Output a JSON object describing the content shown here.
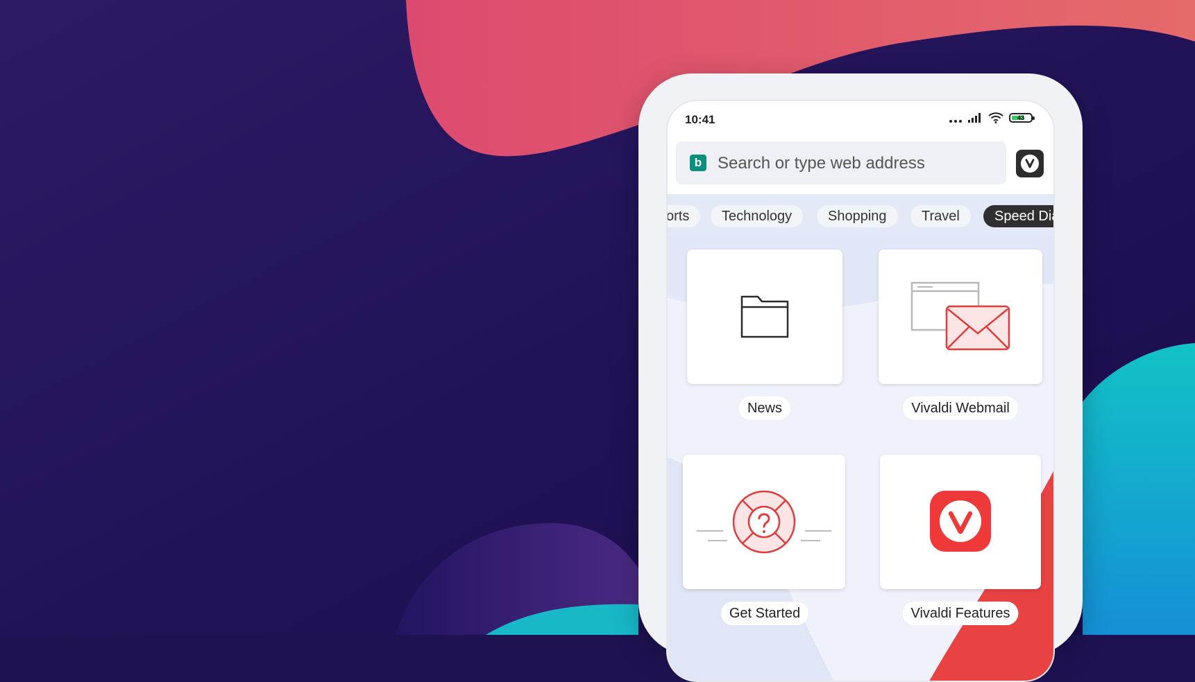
{
  "status_bar": {
    "time": "10:41",
    "battery_level": "43"
  },
  "address_bar": {
    "placeholder": "Search or type web address",
    "engine_icon": "bing-icon"
  },
  "menu_icon": "vivaldi-logo-icon",
  "categories": [
    {
      "label": "orts",
      "active": false
    },
    {
      "label": "Technology",
      "active": false
    },
    {
      "label": "Shopping",
      "active": false
    },
    {
      "label": "Travel",
      "active": false
    },
    {
      "label": "Speed Dia",
      "active": true
    }
  ],
  "speed_dials": [
    {
      "label": "News",
      "icon": "folder-icon"
    },
    {
      "label": "Vivaldi Webmail",
      "icon": "webmail-envelope-icon"
    },
    {
      "label": "Get Started",
      "icon": "lifebuoy-question-icon"
    },
    {
      "label": "Vivaldi Features",
      "icon": "vivaldi-logo-icon"
    }
  ],
  "colors": {
    "background": "#1e1252",
    "coral": "#e0506e",
    "teal": "#18b5c4",
    "vivaldi_red": "#ef3939",
    "bing_teal": "#0d8f7f"
  }
}
